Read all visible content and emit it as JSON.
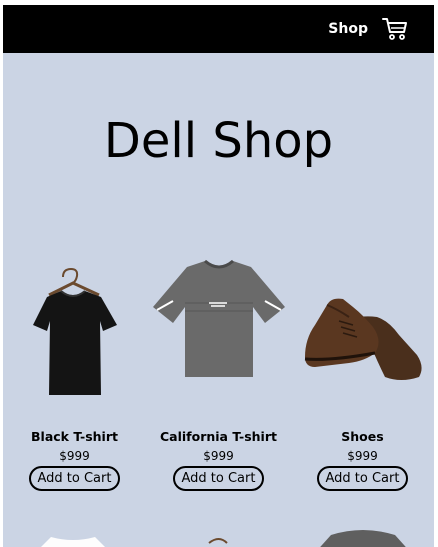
{
  "nav": {
    "shop_label": "Shop",
    "cart_icon": "cart-icon"
  },
  "hero": {
    "title": "Dell Shop"
  },
  "products": [
    {
      "name": "Black T-shirt",
      "price": "$999",
      "button": "Add to Cart"
    },
    {
      "name": "California T-shirt",
      "price": "$999",
      "button": "Add to Cart"
    },
    {
      "name": "Shoes",
      "price": "$999",
      "button": "Add to Cart"
    }
  ],
  "colors": {
    "page_bg": "#cbd4e4",
    "nav_bg": "#000000"
  }
}
